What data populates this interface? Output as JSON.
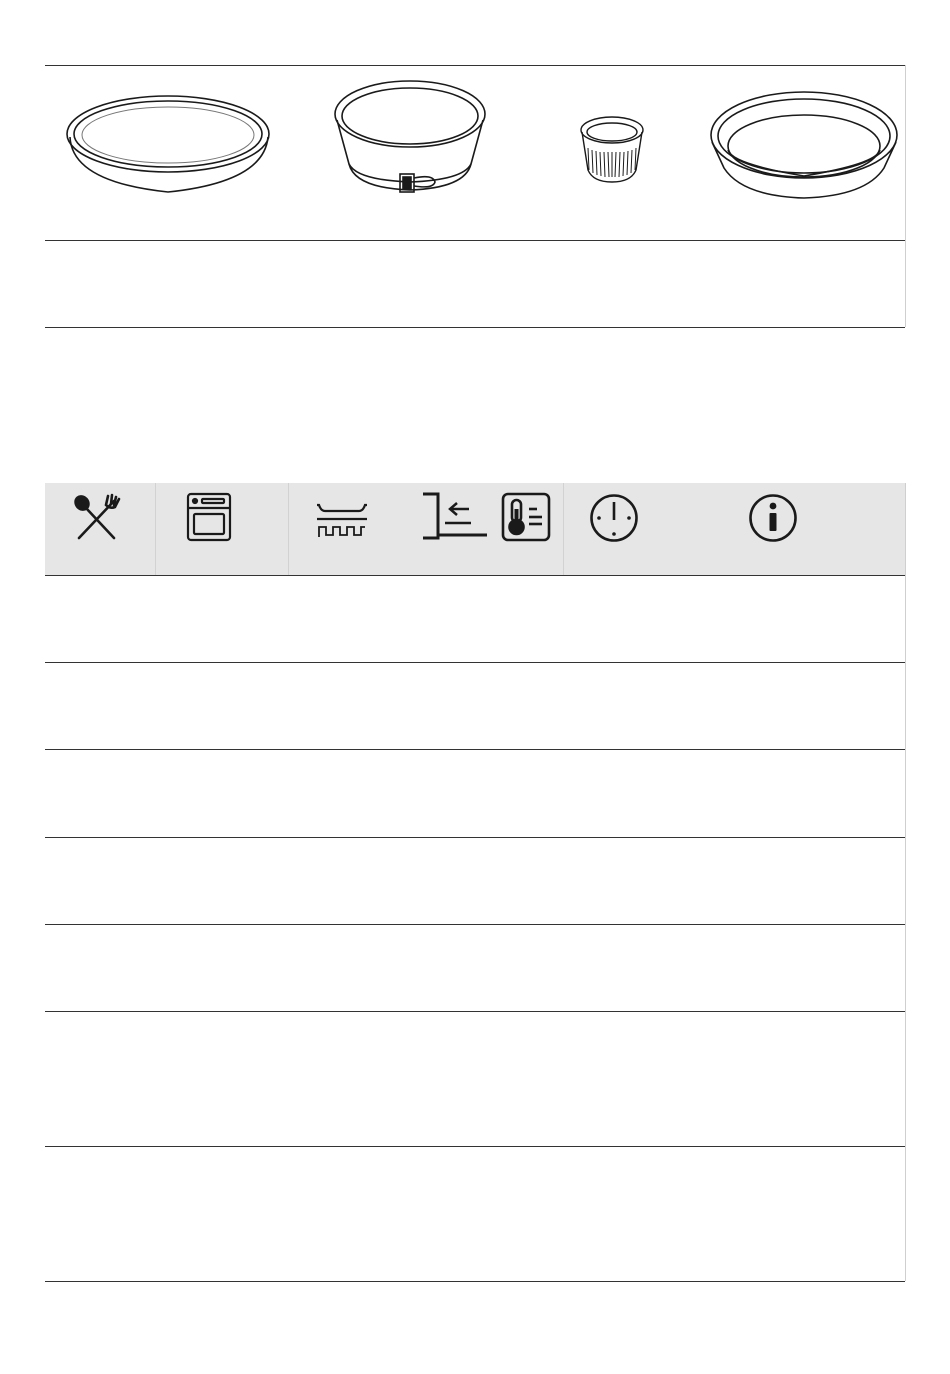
{
  "bakeware_row": {
    "items": [
      {
        "icon": "flat-tart-tin-icon"
      },
      {
        "icon": "springform-tin-icon"
      },
      {
        "icon": "ramekin-icon"
      },
      {
        "icon": "round-deep-tin-icon"
      }
    ]
  },
  "table_header": {
    "columns": [
      {
        "icon": "food-cutlery-icon"
      },
      {
        "icon": "oven-function-icon"
      },
      {
        "icon": "baking-tray-icon"
      },
      {
        "icon": "shelf-position-icon"
      },
      {
        "icon": "temperature-icon"
      },
      {
        "icon": "clock-icon"
      },
      {
        "icon": "info-icon"
      }
    ]
  },
  "table_rows": [
    {
      "cells": []
    },
    {
      "cells": []
    },
    {
      "cells": []
    },
    {
      "cells": []
    },
    {
      "cells": []
    },
    {
      "cells": []
    },
    {
      "cells": []
    }
  ],
  "colors": {
    "header_bg": "#e6e6e6",
    "rule": "#333333",
    "icon": "#1a1a1a"
  }
}
